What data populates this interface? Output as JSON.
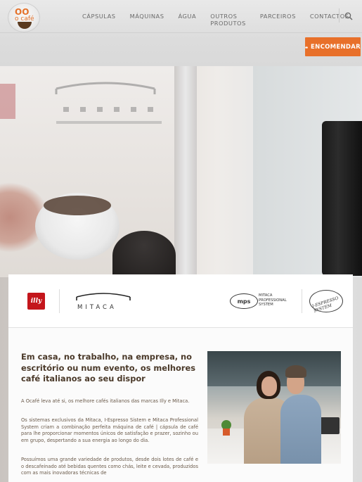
{
  "header": {
    "logo_top": "OO",
    "logo_text": "o café",
    "nav": [
      "CÁPSULAS",
      "MÁQUINAS",
      "ÁGUA",
      "OUTROS PRODUTOS",
      "PARCEIROS",
      "CONTACTOS"
    ],
    "order_button": "ENCOMENDAR"
  },
  "brands": {
    "illy": "illy",
    "mitaca": "MITACA",
    "mps_badge": "mps",
    "mps_line1": "MITACA",
    "mps_line2": "PROFESSIONAL",
    "mps_line3": "SYSTEM",
    "iespresso": "I-ESPRESSO SYSTEM"
  },
  "content": {
    "headline": "Em casa, no trabalho, na empresa, no escritório ou num evento, os melhores café italianos ao seu dispor",
    "p1": "A Ocafé leva até si, os melhore cafés italianos das marcas Illy e Mitaca.",
    "p2": "Os sistemas exclusivos da Mitaca, I-Espresso Sistem e Mitaca Professional System criam a combinação perfeita máquina de café | cápsula de café para lhe proporcionar momentos únicos de satisfação e prazer, sozinho ou em grupo, despertando a sua energia ao longo do dia.",
    "p3": "Possuímos uma grande variedade de produtos, desde dois lotes de café e o descafeinado até bebidas quentes como chás, leite e cevada, produzidos com as mais inovadoras técnicas de"
  },
  "icons": {
    "search": "search-icon",
    "order": "crown-icon"
  },
  "colors": {
    "accent": "#e8702a",
    "illy_red": "#c4161c",
    "text_brown": "#4b3a2a"
  }
}
